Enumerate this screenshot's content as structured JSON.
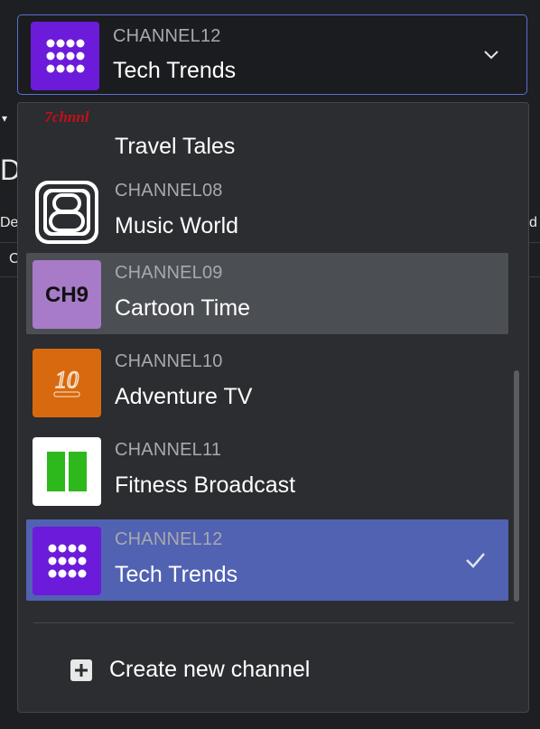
{
  "selector": {
    "code": "CHANNEL12",
    "name": "Tech Trends",
    "logo_icon": "grid-dots-logo-icon"
  },
  "channels": [
    {
      "code": "",
      "name": "Travel Tales",
      "logo_text": "7chnnl",
      "logo_icon": "7chnnl-logo-icon"
    },
    {
      "code": "CHANNEL08",
      "name": "Music World",
      "logo_text": "8",
      "logo_icon": "number-8-logo-icon"
    },
    {
      "code": "CHANNEL09",
      "name": "Cartoon Time",
      "logo_text": "CH9",
      "logo_icon": "ch9-logo-icon"
    },
    {
      "code": "CHANNEL10",
      "name": "Adventure TV",
      "logo_text": "10",
      "logo_icon": "channel-10-logo-icon"
    },
    {
      "code": "CHANNEL11",
      "name": "Fitness Broadcast",
      "logo_icon": "green-split-logo-icon"
    },
    {
      "code": "CHANNEL12",
      "name": "Tech Trends",
      "logo_icon": "grid-dots-logo-icon"
    }
  ],
  "hovered_index": 2,
  "selected_index": 5,
  "create_label": "Create new channel",
  "colors": {
    "accent_border": "#5b6fd6",
    "selected_bg": "#5162b3",
    "hover_bg": "#4b4e53",
    "tech_logo": "#6b1bd9",
    "cartoon_logo": "#a77bc7",
    "adventure_logo": "#d9690e",
    "fitness_green": "#2db81c"
  }
}
